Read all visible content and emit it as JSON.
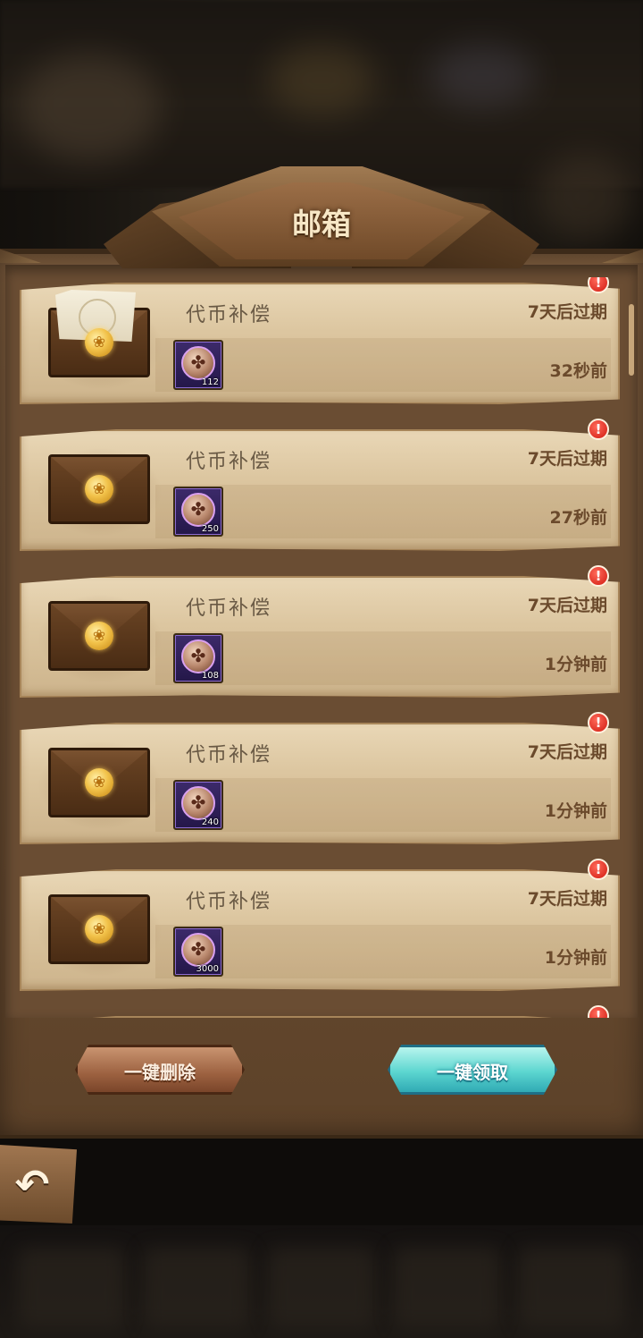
{
  "header": {
    "title": "邮箱"
  },
  "mails": [
    {
      "title": "代币补偿",
      "expiry": "7天后过期",
      "time": "32秒前",
      "item_count": "112",
      "opened": true,
      "alert": "!"
    },
    {
      "title": "代币补偿",
      "expiry": "7天后过期",
      "time": "27秒前",
      "item_count": "250",
      "opened": false,
      "alert": "!"
    },
    {
      "title": "代币补偿",
      "expiry": "7天后过期",
      "time": "1分钟前",
      "item_count": "108",
      "opened": false,
      "alert": "!"
    },
    {
      "title": "代币补偿",
      "expiry": "7天后过期",
      "time": "1分钟前",
      "item_count": "240",
      "opened": false,
      "alert": "!"
    },
    {
      "title": "代币补偿",
      "expiry": "7天后过期",
      "time": "1分钟前",
      "item_count": "3000",
      "opened": false,
      "alert": "!"
    },
    {
      "title": "",
      "expiry": "",
      "time": "",
      "item_count": "",
      "opened": false,
      "alert": "!"
    }
  ],
  "icons": {
    "envelope": "envelope-icon",
    "seal": "wax-seal-icon",
    "item": "clover-token-icon",
    "back": "back-arrow-icon",
    "alert": "alert-icon"
  },
  "actions": {
    "delete_all_label": "一键删除",
    "claim_all_label": "一键领取"
  },
  "colors": {
    "parchment": "#e2cda8",
    "panel": "#6d4f34",
    "claim_button": "#5cd6d0",
    "delete_button": "#9c6140",
    "alert": "#d11a10"
  }
}
